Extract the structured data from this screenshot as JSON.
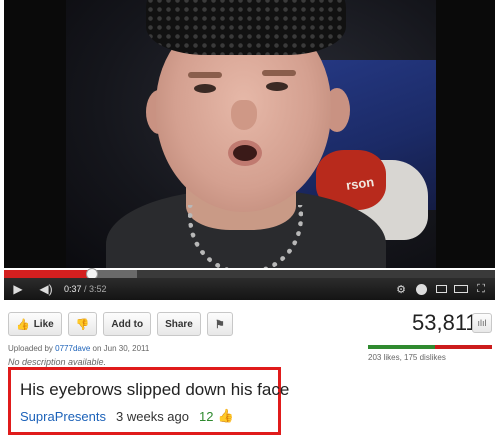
{
  "player": {
    "current_time": "0:37",
    "duration": "/ 3:52",
    "progress_fraction": 0.18,
    "buffered_fraction": 0.27,
    "video_overlay_text": "rson"
  },
  "actions": {
    "like_label": "Like",
    "add_to_label": "Add to",
    "share_label": "Share"
  },
  "stats": {
    "views": "53,811",
    "likes_text": "203 likes, 175 dislikes",
    "like_fraction": 0.537
  },
  "upload": {
    "prefix": "Uploaded by ",
    "user": "0777dave",
    "date": " on Jun 30, 2011",
    "description": "No description available."
  },
  "comment": {
    "text": "His eyebrows slipped down his face",
    "author": "SupraPresents",
    "time": "3 weeks ago",
    "likes": "12"
  },
  "colors": {
    "progress_red": "#d31f1f",
    "link_blue": "#1c62b9",
    "like_green": "#2f8a2f",
    "highlight_red": "#e01b1b"
  }
}
